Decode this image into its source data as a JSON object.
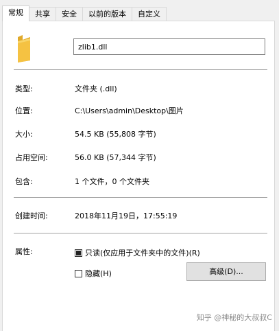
{
  "tabs": [
    {
      "label": "常规",
      "active": true
    },
    {
      "label": "共享",
      "active": false
    },
    {
      "label": "安全",
      "active": false
    },
    {
      "label": "以前的版本",
      "active": false
    },
    {
      "label": "自定义",
      "active": false
    }
  ],
  "file": {
    "name": "zlib1.dll",
    "icon": "folder-icon"
  },
  "properties": {
    "type_label": "类型:",
    "type_value": "文件夹 (.dll)",
    "location_label": "位置:",
    "location_value": "C:\\Users\\admin\\Desktop\\图片",
    "size_label": "大小:",
    "size_value": "54.5 KB (55,808 字节)",
    "size_on_disk_label": "占用空间:",
    "size_on_disk_value": "56.0 KB (57,344 字节)",
    "contains_label": "包含:",
    "contains_value": "1 个文件，0 个文件夹",
    "created_label": "创建时间:",
    "created_value": "2018年11月19日，17:55:19",
    "attributes_label": "属性:"
  },
  "attributes": {
    "readonly_label": "只读(仅应用于文件夹中的文件)(R)",
    "readonly_state": "indeterminate",
    "hidden_label": "隐藏(H)",
    "hidden_state": "unchecked",
    "advanced_button": "高级(D)..."
  },
  "watermark": "知乎 @神秘的大叔叔C",
  "colors": {
    "folder": "#f5c242",
    "folder_dark": "#e0a92a",
    "pane_bg": "#ffffff",
    "window_bg": "#f0f0f0"
  }
}
